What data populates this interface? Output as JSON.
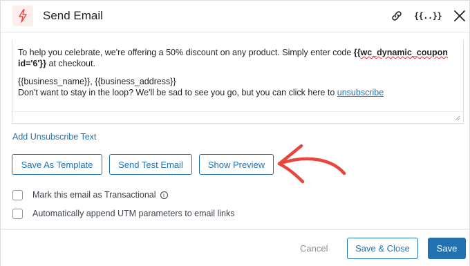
{
  "header": {
    "title": "Send Email",
    "icons": {
      "logo": "lightning-bolt-icon",
      "link": "link-icon",
      "merge_tags": "{{..}}",
      "close": "close-icon"
    }
  },
  "editor": {
    "line1_prefix": "To help you celebrate, we're offering a 50% discount on any product. Simply enter code ",
    "code_open": "{{",
    "code_squiggle": "wc_dynamic_coupon",
    "code_rest": " id='6'}}",
    "line1_suffix": " at checkout.",
    "line2": "{{business_name}}, {{business_address}}",
    "line3_prefix": "Don't want to stay in the loop? We'll be sad to see you go, but you can click here to ",
    "unsubscribe_link": "unsubscribe"
  },
  "add_unsubscribe_text": "Add Unsubscribe Text",
  "buttons": {
    "save_as_template": "Save As Template",
    "send_test_email": "Send Test Email",
    "show_preview": "Show Preview"
  },
  "options": {
    "transactional": {
      "label": "Mark this email as Transactional",
      "checked": false
    },
    "utm": {
      "label": "Automatically append UTM parameters to email links",
      "checked": false
    }
  },
  "footer": {
    "cancel": "Cancel",
    "save_close": "Save & Close",
    "save": "Save"
  },
  "colors": {
    "accent": "#2271b1",
    "annotation_arrow": "#e8453c",
    "logo_bg": "#fdeeee"
  }
}
